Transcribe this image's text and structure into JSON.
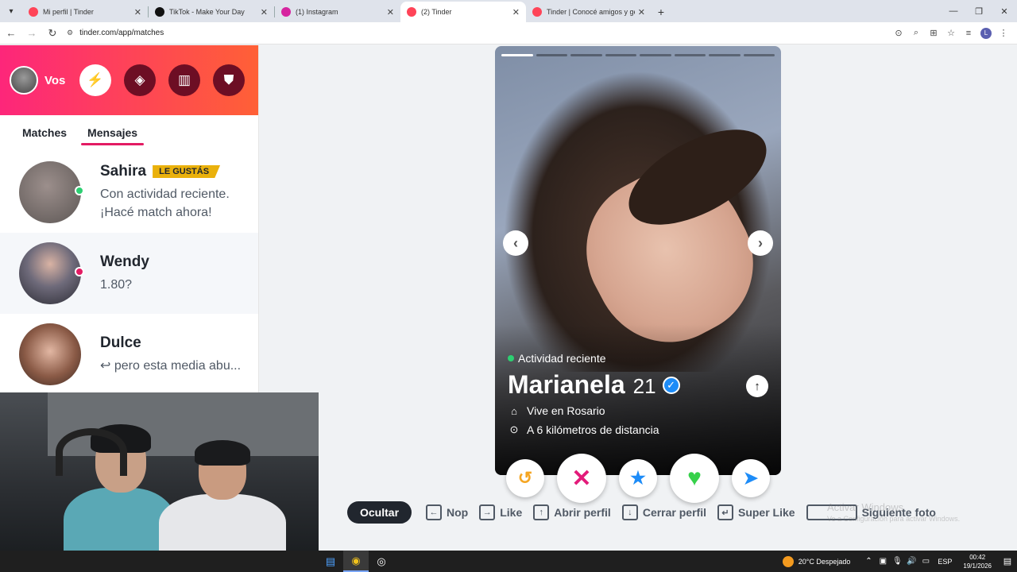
{
  "browser": {
    "tabs": [
      {
        "title": "Mi perfil | Tinder",
        "favicon_color": "#ff4458"
      },
      {
        "title": "TikTok - Make Your Day",
        "favicon_color": "#111111"
      },
      {
        "title": "(1) Instagram",
        "favicon_color": "#d6249f"
      },
      {
        "title": "(2) Tinder",
        "favicon_color": "#ff4458"
      },
      {
        "title": "Tinder | Conocé amigos y gente",
        "favicon_color": "#ff4458"
      }
    ],
    "active_tab_index": 3,
    "url": "tinder.com/app/matches",
    "profile_initial": "L"
  },
  "sidebar": {
    "me_label": "Vos",
    "header_buttons": [
      "boost-icon",
      "explore-icon",
      "briefcase-icon",
      "shield-icon"
    ],
    "tabs": [
      {
        "label": "Matches",
        "active": false
      },
      {
        "label": "Mensajes",
        "active": true
      }
    ],
    "messages": [
      {
        "name": "Sahira",
        "badge": "LE GUSTÁS",
        "line1": "Con actividad reciente.",
        "line2": "¡Hacé match ahora!",
        "status_color": "#2dcf72"
      },
      {
        "name": "Wendy",
        "line1": "1.80?",
        "status_color": "#e31b63"
      },
      {
        "name": "Dulce",
        "line1": "↩ pero esta media abu..."
      }
    ]
  },
  "card": {
    "photo_count": 8,
    "current_photo": 1,
    "activity": "Actividad reciente",
    "name": "Marianela",
    "age": "21",
    "lives_in": "Vive en Rosario",
    "distance": "A 6 kilómetros de distancia"
  },
  "actions": [
    {
      "name": "rewind",
      "glyph": "↺",
      "color": "#f5a623",
      "size": "s"
    },
    {
      "name": "nope",
      "glyph": "✕",
      "color": "#e31b7a",
      "size": "l"
    },
    {
      "name": "super-like",
      "glyph": "★",
      "color": "#1d8cf8",
      "size": "s"
    },
    {
      "name": "like",
      "glyph": "♥",
      "color": "#36d14a",
      "size": "l"
    },
    {
      "name": "boost",
      "glyph": "➤",
      "color": "#1d8cf8",
      "size": "s"
    }
  ],
  "shortcuts": {
    "hide_label": "Ocultar",
    "items": [
      {
        "key": "←",
        "label": "Nop"
      },
      {
        "key": "→",
        "label": "Like"
      },
      {
        "key": "↑",
        "label": "Abrir perfil"
      },
      {
        "key": "↓",
        "label": "Cerrar perfil"
      },
      {
        "key": "↵",
        "label": "Super Like"
      },
      {
        "key": "",
        "label": "Siguiente foto",
        "wide": true
      }
    ]
  },
  "watermark": {
    "line1": "Activar Windows",
    "line2": "Ve a Configuración para activar Windows."
  },
  "taskbar": {
    "weather": "20°C  Despejado",
    "lang": "ESP",
    "time": "00:42",
    "date": "19/1/2026"
  }
}
